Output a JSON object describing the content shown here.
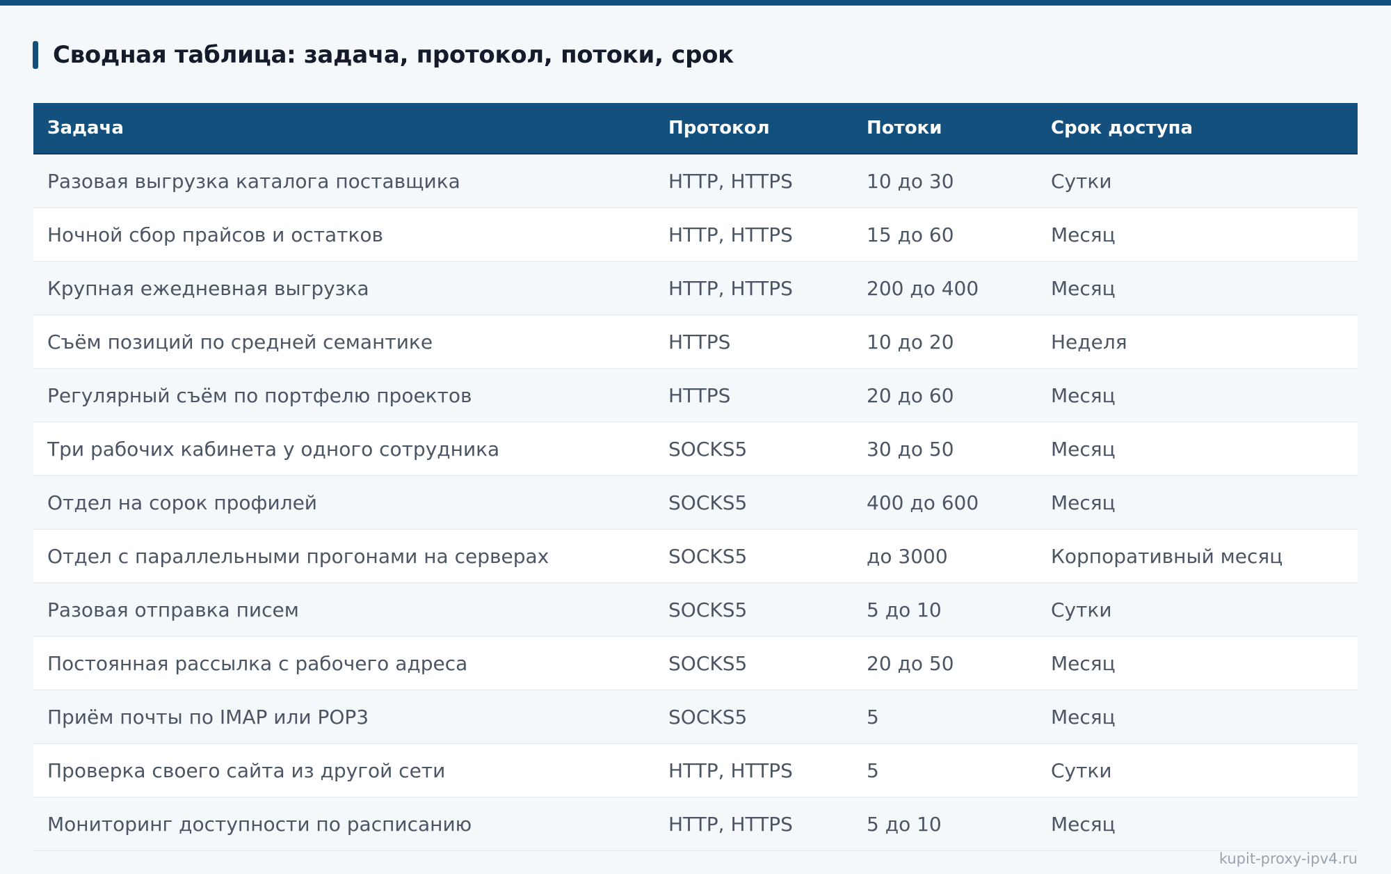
{
  "page": {
    "title": "Сводная таблица: задача, протокол, потоки, срок",
    "watermark": "kupit-proxy-ipv4.ru",
    "accent_color": "#13507e"
  },
  "table": {
    "headers": [
      "Задача",
      "Протокол",
      "Потоки",
      "Срок доступа"
    ],
    "rows": [
      [
        "Разовая выгрузка каталога поставщика",
        "HTTP, HTTPS",
        "10 до 30",
        "Сутки"
      ],
      [
        "Ночной сбор прайсов и остатков",
        "HTTP, HTTPS",
        "15 до 60",
        "Месяц"
      ],
      [
        "Крупная ежедневная выгрузка",
        "HTTP, HTTPS",
        "200 до 400",
        "Месяц"
      ],
      [
        "Съём позиций по средней семантике",
        "HTTPS",
        "10 до 20",
        "Неделя"
      ],
      [
        "Регулярный съём по портфелю проектов",
        "HTTPS",
        "20 до 60",
        "Месяц"
      ],
      [
        "Три рабочих кабинета у одного сотрудника",
        "SOCKS5",
        "30 до 50",
        "Месяц"
      ],
      [
        "Отдел на сорок профилей",
        "SOCKS5",
        "400 до 600",
        "Месяц"
      ],
      [
        "Отдел с параллельными прогонами на серверах",
        "SOCKS5",
        "до 3000",
        "Корпоративный месяц"
      ],
      [
        "Разовая отправка писем",
        "SOCKS5",
        "5 до 10",
        "Сутки"
      ],
      [
        "Постоянная рассылка с рабочего адреса",
        "SOCKS5",
        "20 до 50",
        "Месяц"
      ],
      [
        "Приём почты по IMAP или POP3",
        "SOCKS5",
        "5",
        "Месяц"
      ],
      [
        "Проверка своего сайта из другой сети",
        "HTTP, HTTPS",
        "5",
        "Сутки"
      ],
      [
        "Мониторинг доступности по расписанию",
        "HTTP, HTTPS",
        "5 до 10",
        "Месяц"
      ]
    ]
  }
}
